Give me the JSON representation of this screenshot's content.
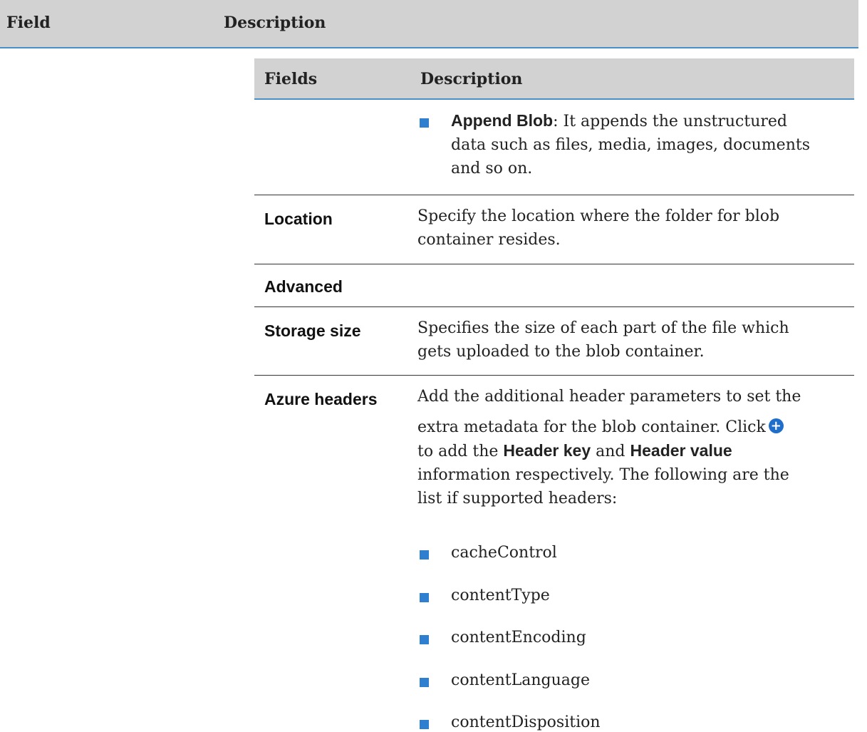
{
  "outer_header": {
    "field_label": "Field",
    "description_label": "Description"
  },
  "inner_header": {
    "fields_label": "Fields",
    "description_label": "Description"
  },
  "rows": {
    "append_blob": {
      "term": "Append Blob",
      "text": ": It appends the unstructured",
      "line2": "data such as files, media, images, documents",
      "line3": "and so on."
    },
    "location": {
      "field": "Location",
      "line1": "Specify the location where the folder for blob",
      "line2": "container resides."
    },
    "advanced": {
      "field": "Advanced"
    },
    "storage_size": {
      "field": "Storage size",
      "line1": "Specifies the size of each part of the file which",
      "line2": "gets uploaded to the blob container."
    },
    "azure_headers": {
      "field": "Azure headers",
      "line1": "Add the additional header parameters to set the",
      "line2_a": "extra metadata for the blob container. Click",
      "line3_a": "to add the ",
      "line3_b": "Header key",
      "line3_c": " and ",
      "line3_d": "Header value",
      "line4": "information respectively. The following are the",
      "line5": "list if supported headers:",
      "headers": [
        "cacheControl",
        "contentType",
        "contentEncoding",
        "contentLanguage",
        "contentDisposition"
      ]
    }
  },
  "icons": {
    "add": "plus-circle-icon",
    "bullet_color": "#2e7fd0"
  }
}
